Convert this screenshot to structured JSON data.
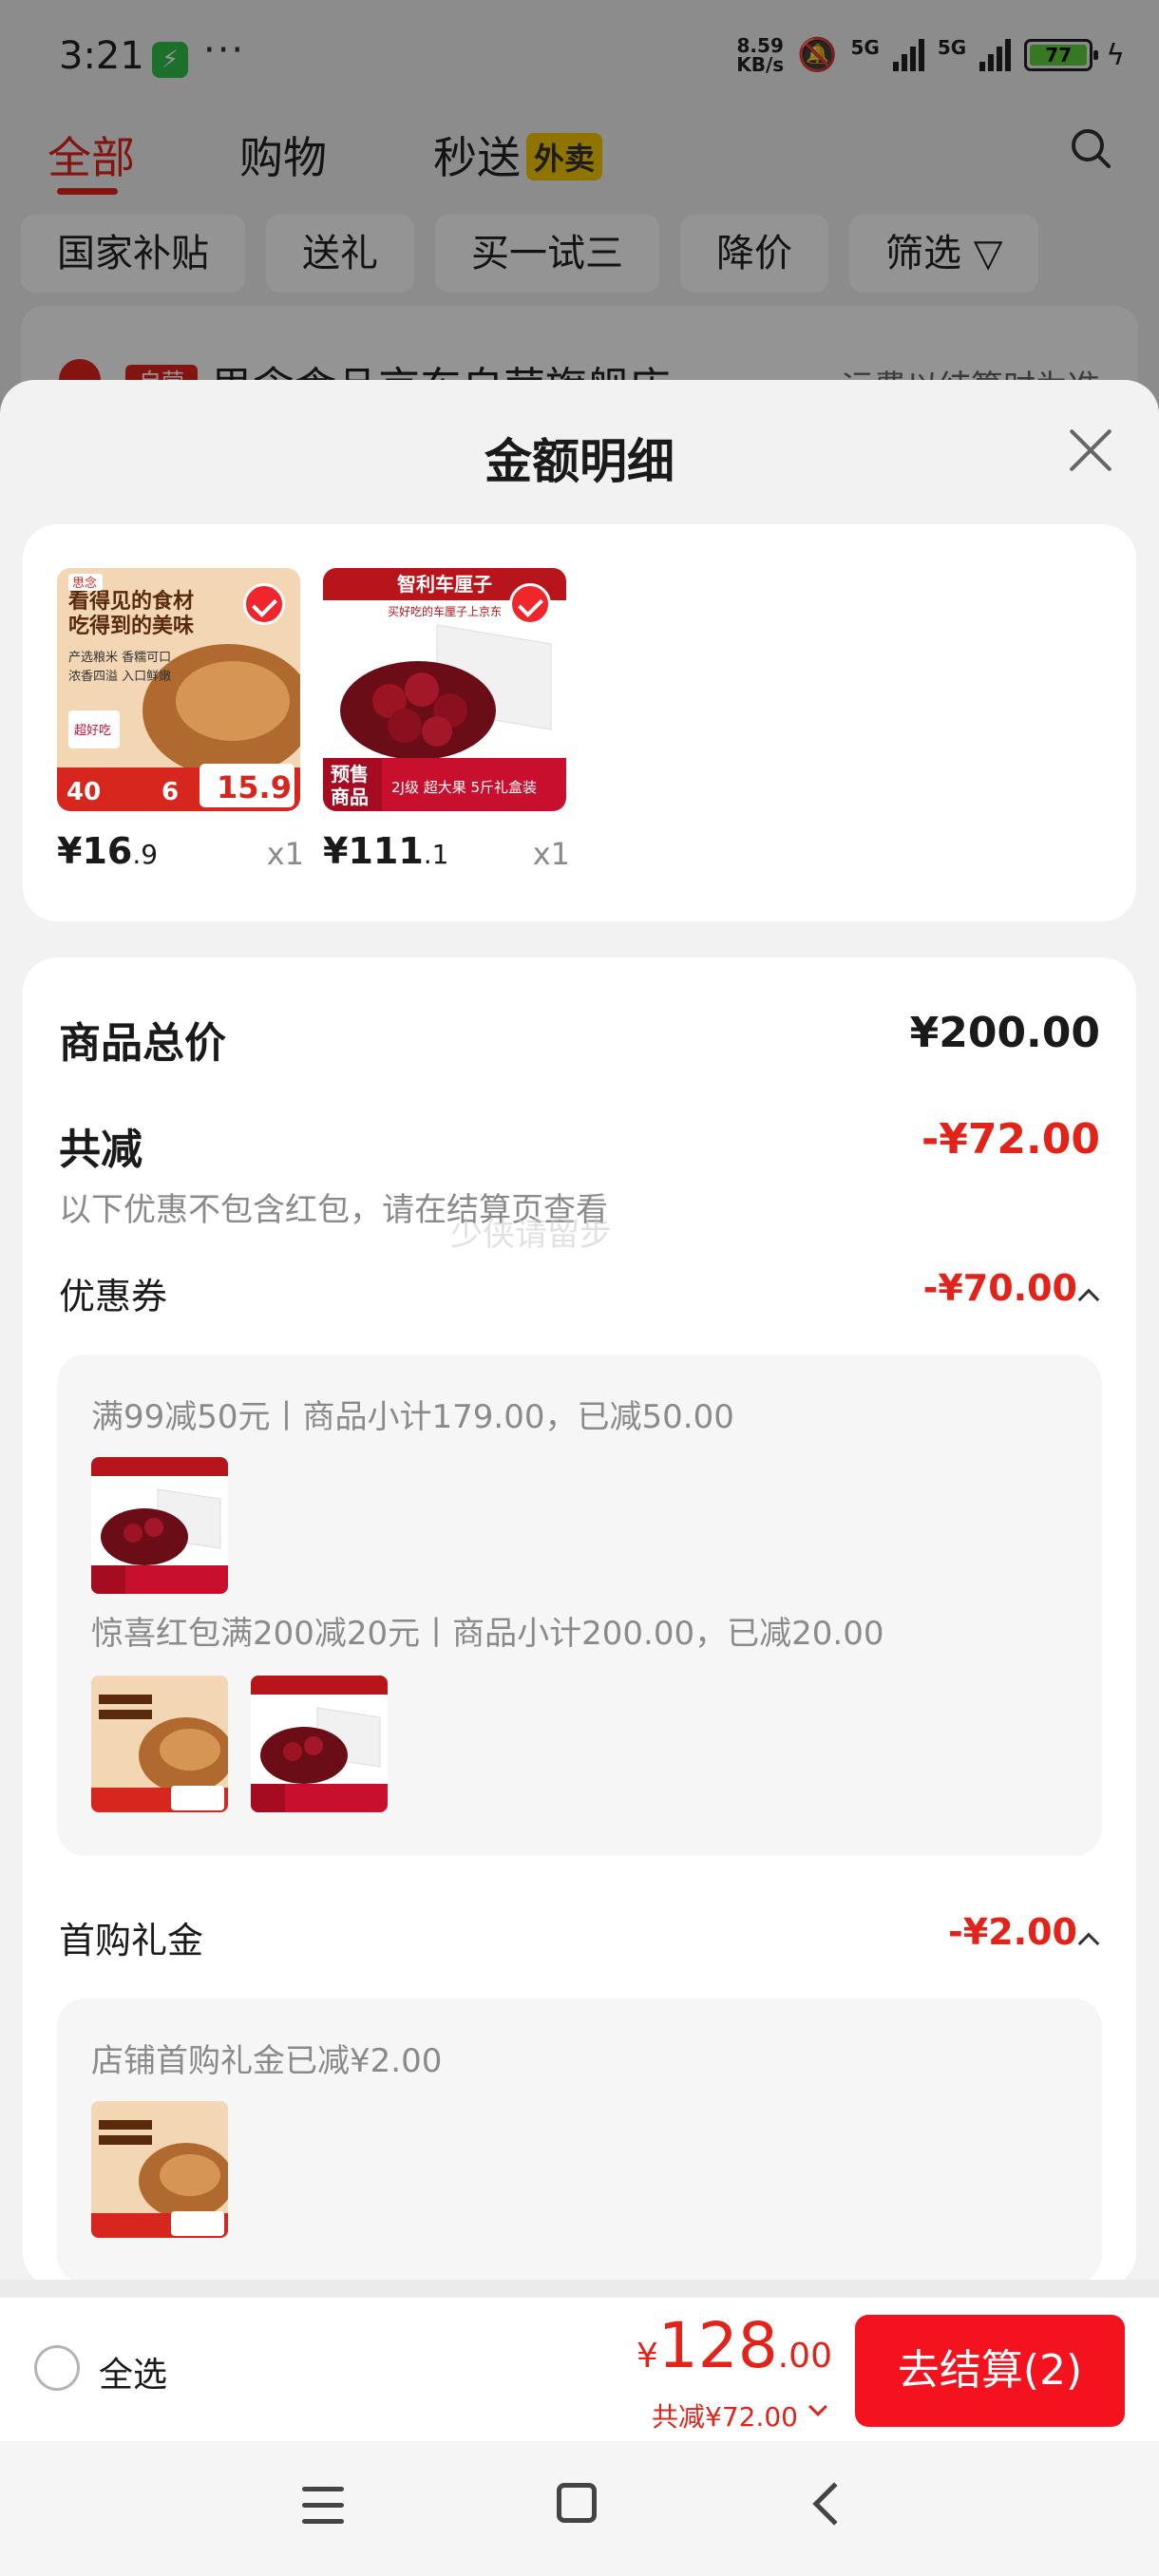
{
  "status_bar": {
    "time": "3:21",
    "dots": "···",
    "net_speed_value": "8.59",
    "net_speed_unit": "KB/s",
    "sig1": "5G",
    "sig2": "5G",
    "battery": "77",
    "battery_level_percent": 77
  },
  "background": {
    "tabs": [
      "全部",
      "购物",
      "秒送"
    ],
    "takeout_badge": "外卖",
    "chips": [
      "国家补贴",
      "送礼",
      "买一试三",
      "降价",
      "筛选 ▽"
    ],
    "store_name": "思念食品京东自营旗舰店 ›",
    "store_tag": "自营",
    "shipping_note": "运费以结算时为准"
  },
  "sheet": {
    "title": "金额明细",
    "products": [
      {
        "price_int": "¥16",
        "price_dec": ".9",
        "qty": "x1"
      },
      {
        "price_int": "¥111",
        "price_dec": ".1",
        "qty": "x1"
      }
    ],
    "total_label": "商品总价",
    "total_value": "¥200.00",
    "reduce_label": "共减",
    "reduce_value": "-¥72.00",
    "note": "以下优惠不包含红包，请在结算页查看",
    "watermark": "少侠请留步",
    "coupon_label": "优惠券",
    "coupon_value": "-¥70.00",
    "coupon_rule_1": "满99减50元丨商品小计179.00，已减50.00",
    "coupon_rule_2": "惊喜红包满200减20元丨商品小计200.00，已减20.00",
    "gift_label": "首购礼金",
    "gift_value": "-¥2.00",
    "gift_rule": "店铺首购礼金已减¥2.00"
  },
  "product_art": {
    "dumpling": {
      "headline1": "看得见的食材",
      "headline2": "吃得到的美味",
      "bullet1": "产选粮米 香糯可口",
      "bullet2": "浓香四溢 入口鲜嫩",
      "brand": "思念",
      "promo_badge": "超好吃",
      "price_tag": "15.9",
      "left_tag": "40",
      "mid_tag": "6"
    },
    "cherry": {
      "banner": "智利车厘子",
      "subtitle": "买好吃的车厘子上京东",
      "corner1": "预售",
      "corner2": "商品",
      "footer": "2J级 超大果 5斤礼盒装"
    }
  },
  "bottom_bar": {
    "select_all": "全选",
    "total_yen": "¥",
    "total_big": "128",
    "total_cents": ".00",
    "total_reduce": "共减¥72.00",
    "checkout": "去结算(2)"
  },
  "colors": {
    "accent_red": "#e2231a",
    "checkout_red": "#f5121f"
  }
}
